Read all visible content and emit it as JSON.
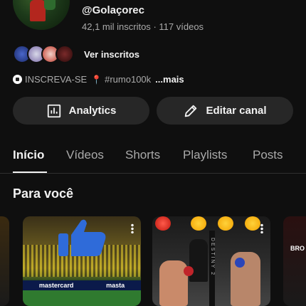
{
  "channel": {
    "handle": "@Golaçorec",
    "subscribers": "42,1 mil inscritos",
    "separator": "·",
    "videos": "117 vídeos",
    "subs_link": "Ver inscritos",
    "description_a": "INSCREVA-SE",
    "description_b": "#rumo100k",
    "more": "...mais"
  },
  "actions": {
    "analytics": "Analytics",
    "edit": "Editar canal"
  },
  "tabs": [
    "Início",
    "Vídeos",
    "Shorts",
    "Playlists",
    "Posts"
  ],
  "section": {
    "title": "Para você"
  },
  "thumbnails": {
    "banner_left": "mastercard",
    "banner_right": "masta",
    "ring_text": "DESTINY 2",
    "peek_right": "BRO"
  },
  "colors": {
    "background": "#0f0f0f",
    "button": "#272727",
    "text_primary": "#f1f1f1",
    "text_secondary": "#aaaaaa",
    "thumbs_blue": "#2f6bd9"
  },
  "icons": [
    "analytics-icon",
    "pencil-icon",
    "soccer-ball-icon",
    "pin-icon",
    "more-vertical-icon",
    "thumbs-up-icon"
  ]
}
